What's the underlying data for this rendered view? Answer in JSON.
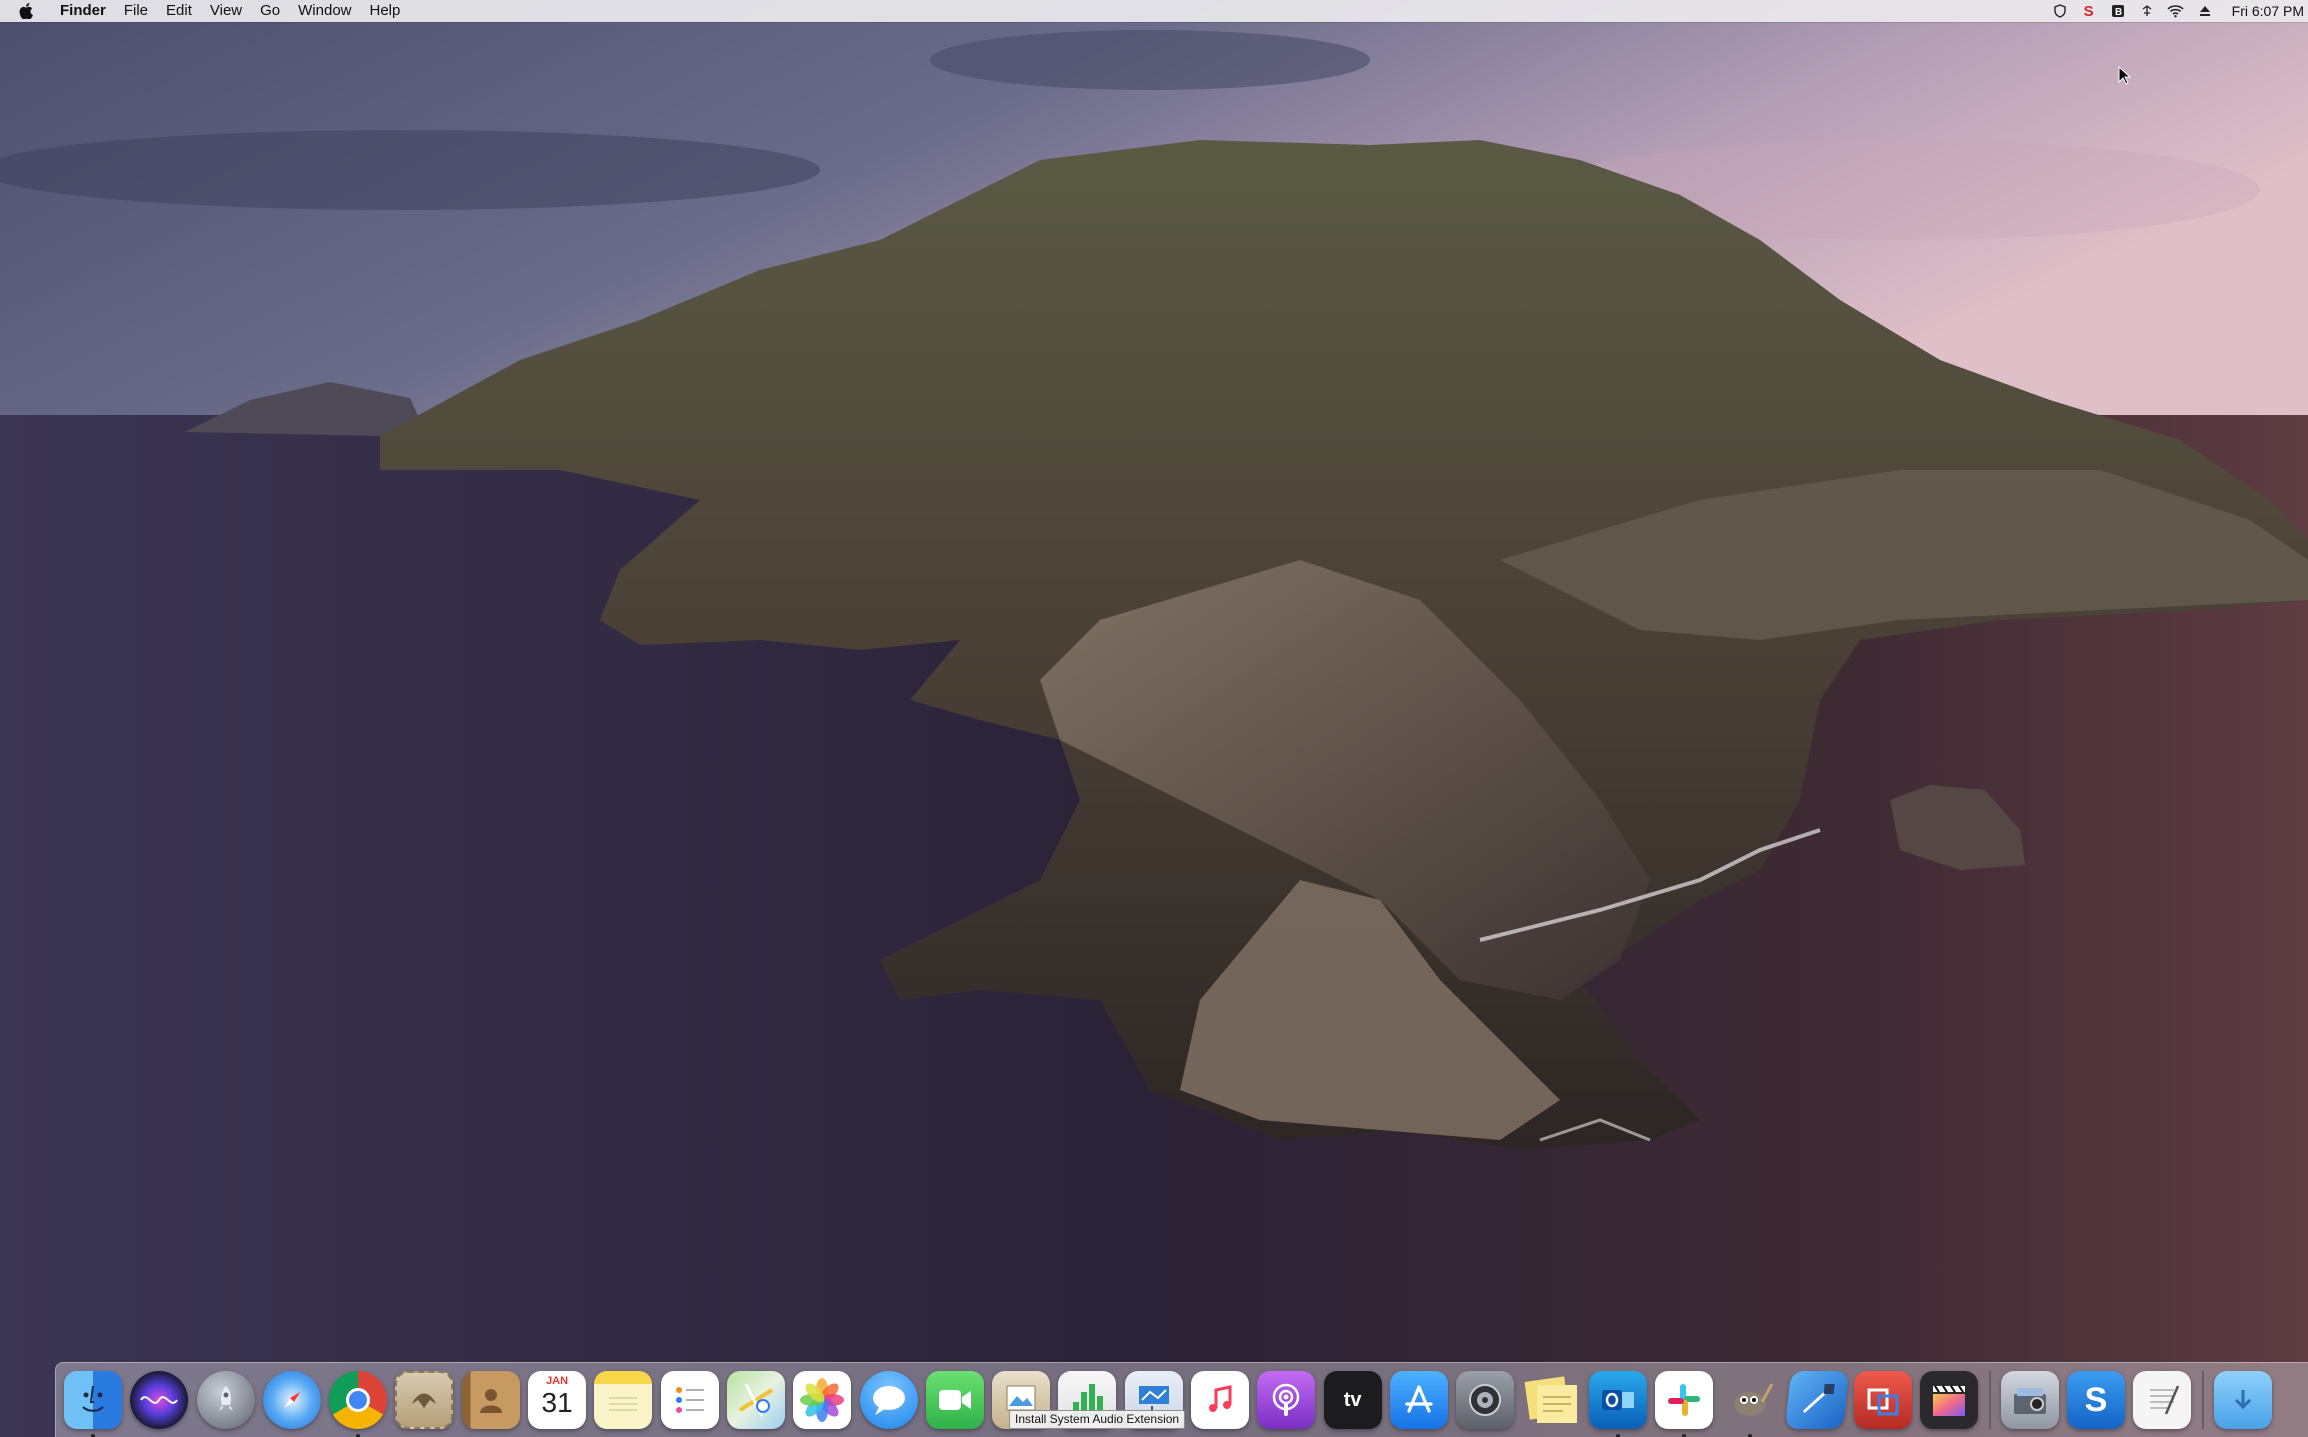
{
  "menubar": {
    "app_name": "Finder",
    "menus": [
      "File",
      "Edit",
      "View",
      "Go",
      "Window",
      "Help"
    ],
    "status_icons": [
      "vpn-shield-icon",
      "app-s-icon",
      "app-b-icon",
      "input-icon",
      "wifi-icon",
      "eject-icon"
    ],
    "clock": "Fri 6:07 PM"
  },
  "calendar": {
    "month": "JAN",
    "day": "31"
  },
  "dock": {
    "tooltip": "Install System Audio Extension",
    "apps": [
      {
        "name": "Finder",
        "icon": "finder-icon",
        "color": "#3d8ef0",
        "running": true
      },
      {
        "name": "Siri",
        "icon": "siri-icon",
        "color": "#2a2a48",
        "running": false
      },
      {
        "name": "Launchpad",
        "icon": "launchpad-icon",
        "color": "#8a8f98",
        "running": false
      },
      {
        "name": "Safari",
        "icon": "safari-icon",
        "color": "#2b8ff0",
        "running": false
      },
      {
        "name": "Chrome",
        "icon": "chrome-icon",
        "color": "#e8e8e8",
        "running": true
      },
      {
        "name": "Mail",
        "icon": "mail-icon",
        "color": "#c9b79a",
        "running": false
      },
      {
        "name": "Contacts",
        "icon": "contacts-icon",
        "color": "#b88a55",
        "running": false
      },
      {
        "name": "Calendar",
        "icon": "calendar-icon",
        "color": "#ffffff",
        "running": false
      },
      {
        "name": "Notes",
        "icon": "notes-icon",
        "color": "#f7e27a",
        "running": false
      },
      {
        "name": "Reminders",
        "icon": "reminders-icon",
        "color": "#ffffff",
        "running": false
      },
      {
        "name": "Maps",
        "icon": "maps-icon",
        "color": "#9ccf8a",
        "running": false
      },
      {
        "name": "Photos",
        "icon": "photos-icon",
        "color": "#f4f4f4",
        "running": false
      },
      {
        "name": "Messages",
        "icon": "messages-icon",
        "color": "#3ba2f5",
        "running": false
      },
      {
        "name": "FaceTime",
        "icon": "facetime-icon",
        "color": "#4cc35a",
        "running": false
      },
      {
        "name": "Preview",
        "icon": "preview-icon",
        "color": "#d9d0c0",
        "running": false
      },
      {
        "name": "Numbers",
        "icon": "numbers-icon",
        "color": "#33b054",
        "running": false
      },
      {
        "name": "Keynote",
        "icon": "keynote-icon",
        "color": "#2f7fd6",
        "running": false
      },
      {
        "name": "Music",
        "icon": "music-icon",
        "color": "#fc4d6a",
        "running": false
      },
      {
        "name": "Podcasts",
        "icon": "podcasts-icon",
        "color": "#9b4ed9",
        "running": false
      },
      {
        "name": "TV",
        "icon": "tv-icon",
        "color": "#1c1c1e",
        "running": false
      },
      {
        "name": "App Store",
        "icon": "app-store-icon",
        "color": "#2d8cf0",
        "running": false
      },
      {
        "name": "System Preferences",
        "icon": "system-preferences-icon",
        "color": "#7b7f86",
        "running": false
      },
      {
        "name": "Stickies",
        "icon": "stickies-icon",
        "color": "#efdb7a",
        "running": false
      },
      {
        "name": "Outlook",
        "icon": "outlook-icon",
        "color": "#1f6fc5",
        "running": true
      },
      {
        "name": "Slack",
        "icon": "slack-icon",
        "color": "#ffffff",
        "running": true
      },
      {
        "name": "GIMP",
        "icon": "gimp-icon",
        "color": "#7c7368",
        "running": true
      },
      {
        "name": "Xcode",
        "icon": "xcode-icon",
        "color": "#3a8ee6",
        "running": false
      },
      {
        "name": "Parallels",
        "icon": "parallels-icon",
        "color": "#d8413a",
        "running": false
      },
      {
        "name": "Final Cut Pro",
        "icon": "final-cut-pro-icon",
        "color": "#2a2a2e",
        "running": false
      },
      {
        "name": "Image Capture",
        "icon": "image-capture-icon",
        "color": "#aab2bd",
        "running": false
      },
      {
        "name": "Sidebar S",
        "icon": "s-app-icon",
        "color": "#1e7fd8",
        "running": false
      },
      {
        "name": "TextEdit",
        "icon": "textedit-icon",
        "color": "#f2f2f2",
        "running": false
      },
      {
        "name": "Downloads",
        "icon": "downloads-folder-icon",
        "color": "#6bb6f0",
        "running": false
      }
    ]
  }
}
